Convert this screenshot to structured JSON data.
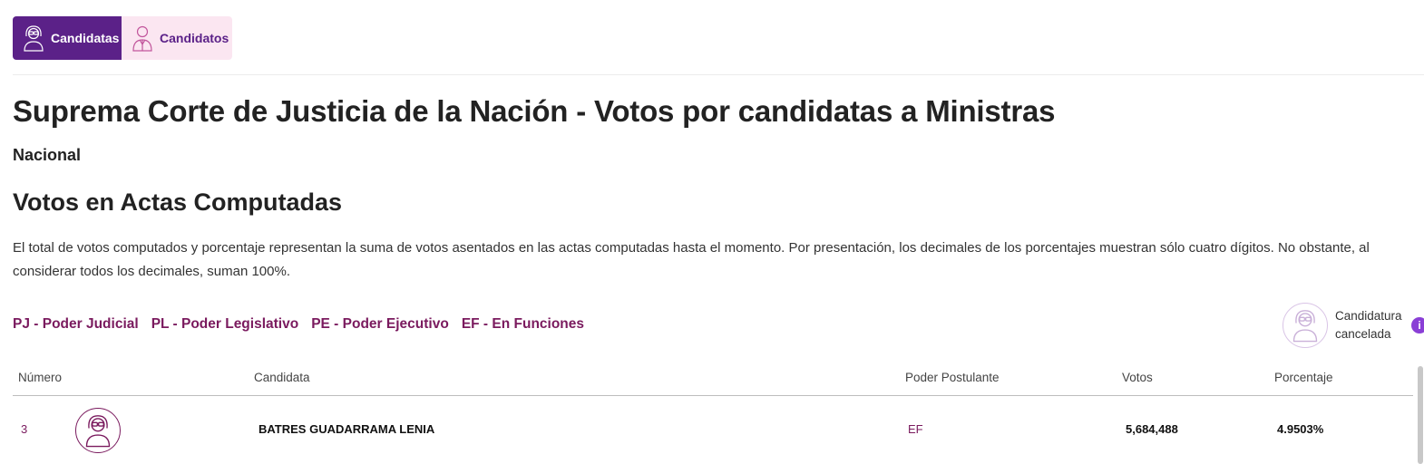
{
  "tabs": [
    {
      "label": "Candidatas",
      "icon": "female-candidate-icon",
      "active": true
    },
    {
      "label": "Candidatos",
      "icon": "male-candidate-icon",
      "active": false
    }
  ],
  "page_title": "Suprema Corte de Justicia de la Nación - Votos por candidatas a Ministras",
  "scope": "Nacional",
  "section_title": "Votos en Actas Computadas",
  "description": "El total de votos computados y porcentaje representan la suma de votos asentados en las actas computadas hasta el momento. Por presentación, los decimales de los porcentajes muestran sólo cuatro dígitos. No obstante, al considerar todos los decimales, suman 100%.",
  "legend": [
    "PJ - Poder Judicial",
    "PL - Poder Legislativo",
    "PE - Poder Ejecutivo",
    "EF - En Funciones"
  ],
  "cancel_legend": {
    "line1": "Candidatura",
    "line2": "cancelada",
    "icon": "cancelled-candidate-icon"
  },
  "colors": {
    "primary": "#5b2188",
    "accent": "#7a1a5e",
    "tab_inactive_bg": "#fbe6f1",
    "info": "#8a3fd6"
  },
  "table": {
    "headers": [
      "Número",
      "Candidata",
      "Poder Postulante",
      "Votos",
      "Porcentaje"
    ],
    "rows": [
      {
        "numero": "3",
        "candidata": "BATRES GUADARRAMA LENIA",
        "poder": "EF",
        "votos": "5,684,488",
        "porcentaje": "4.9503%"
      }
    ]
  }
}
